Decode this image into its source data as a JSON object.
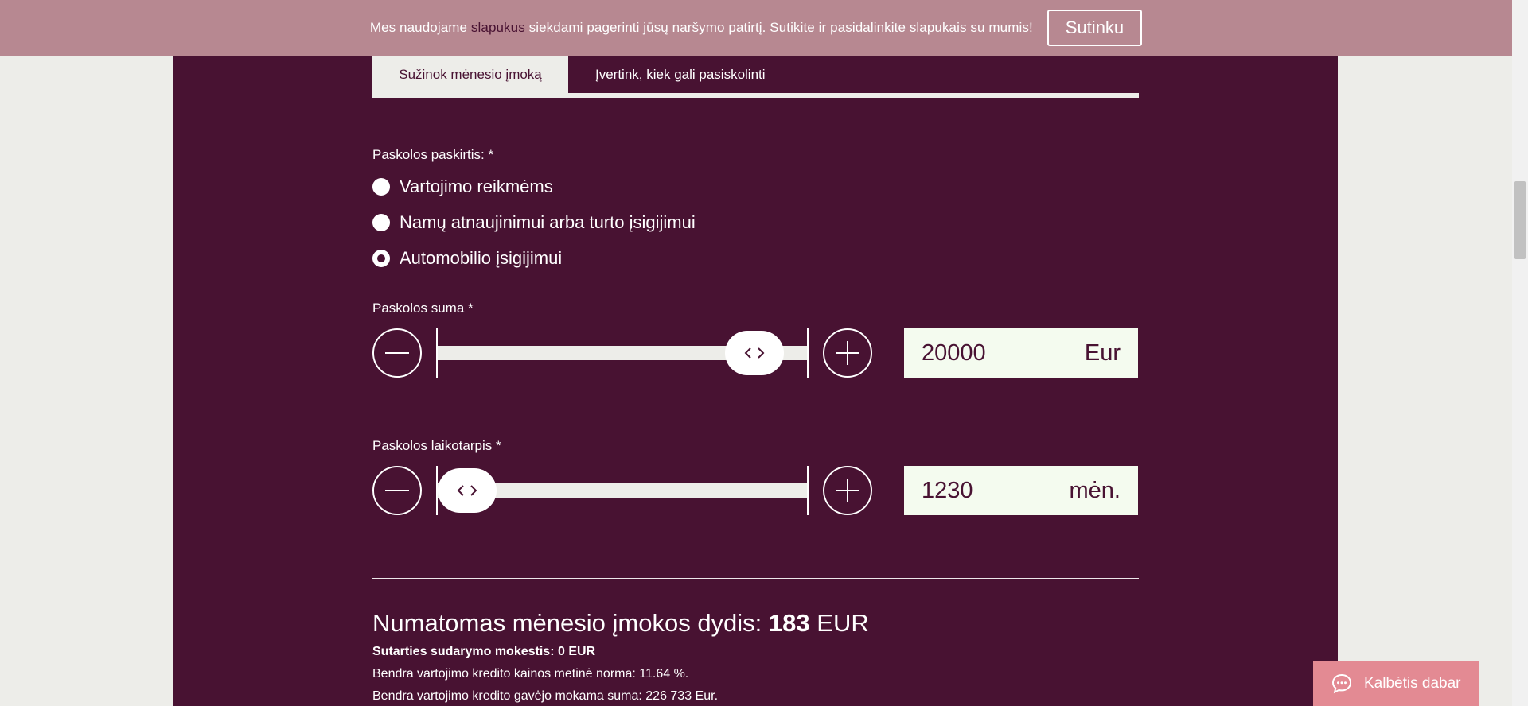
{
  "cookie": {
    "text_before": "Mes naudojame ",
    "link_text": "slapukus",
    "text_after": " siekdami pagerinti jūsų naršymo patirtį. Sutikite ir pasidalinkite slapukais su mumis!",
    "accept_label": "Sutinku"
  },
  "tabs": {
    "active_label": "Sužinok mėnesio įmoką",
    "inactive_label": "Įvertink, kiek gali pasiskolinti"
  },
  "purpose": {
    "label": "Paskolos paskirtis: *",
    "options": [
      {
        "label": "Vartojimo reikmėms",
        "checked": false
      },
      {
        "label": "Namų atnaujinimui arba turto įsigijimui",
        "checked": false
      },
      {
        "label": "Automobilio įsigijimui",
        "checked": true
      }
    ]
  },
  "amount": {
    "label": "Paskolos suma  *",
    "value": "20000",
    "unit": "Eur",
    "slider_level": 0.92
  },
  "term": {
    "label": "Paskolos laikotarpis *",
    "value": "1230",
    "unit": "mėn.",
    "slider_level": 0.0
  },
  "result": {
    "title_prefix": "Numatomas mėnesio įmokos dydis: ",
    "monthly_value": "183",
    "title_suffix": " EUR",
    "fee_line": "Sutarties sudarymo mokestis: 0 EUR",
    "rate_line": "Bendra vartojimo kredito kainos metinė norma: 11.64 %.",
    "total_line": "Bendra vartojimo kredito gavėjo mokama suma: 226 733 Eur."
  },
  "chat": {
    "label": "Kalbėtis dabar"
  },
  "colors": {
    "background": "#481232",
    "cookie_bar": "#b78891",
    "chat_button": "#e38a93",
    "input_bg": "#f4fbef"
  }
}
